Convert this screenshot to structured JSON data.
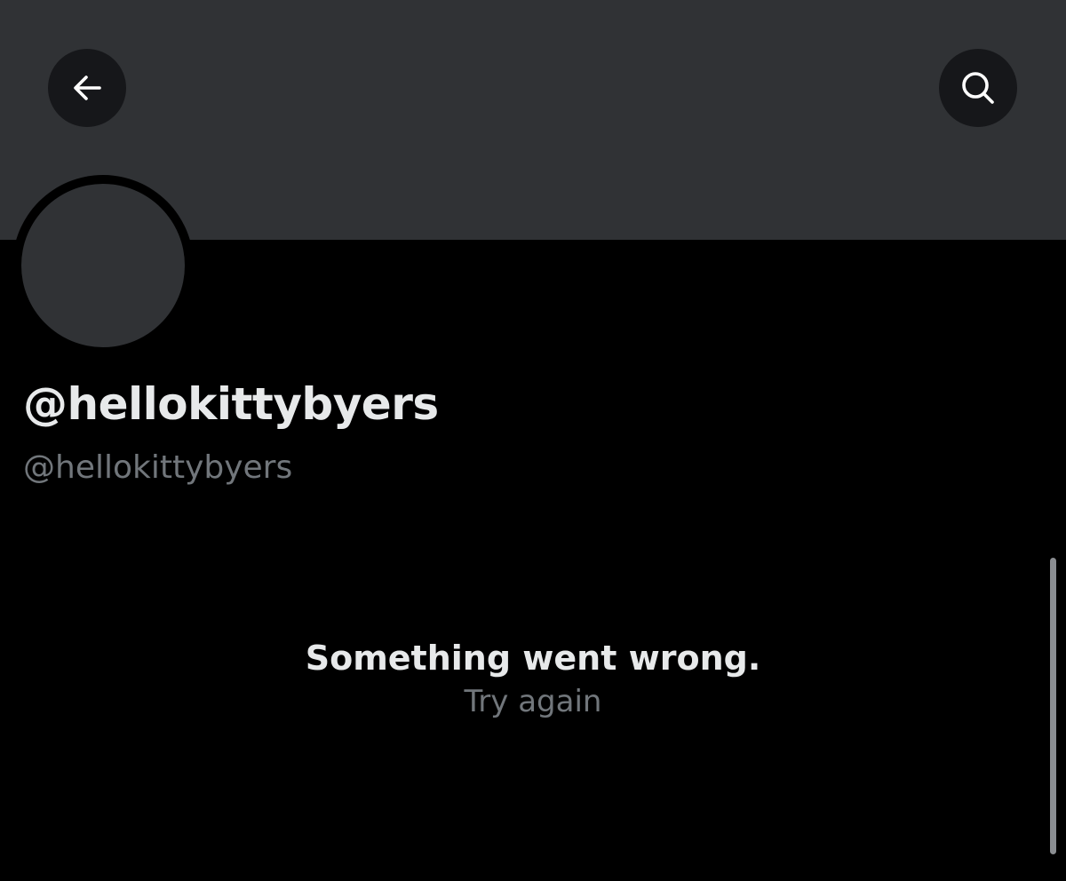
{
  "header": {
    "back_icon": "arrow-left-icon",
    "search_icon": "search-icon"
  },
  "profile": {
    "display_name": "@hellokittybyers",
    "handle": "@hellokittybyers"
  },
  "error": {
    "title": "Something went wrong.",
    "retry_label": "Try again"
  },
  "colors": {
    "banner": "#303235",
    "background": "#000000",
    "primary_text": "#e7e9ea",
    "secondary_text": "#71767b"
  }
}
